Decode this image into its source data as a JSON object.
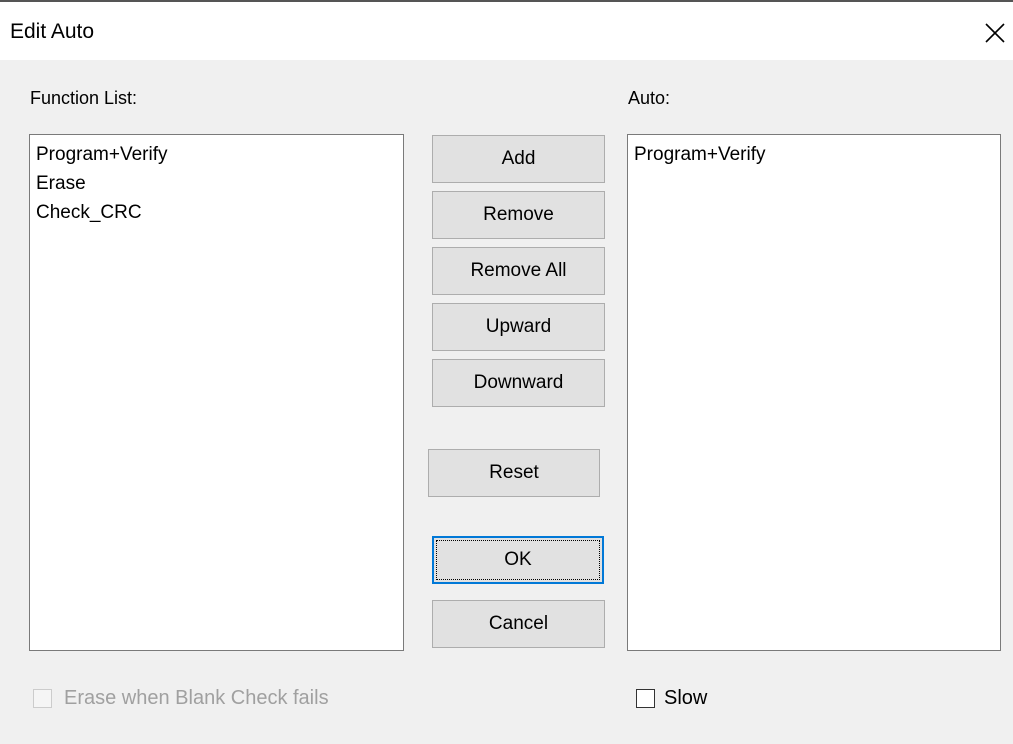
{
  "window": {
    "title": "Edit Auto"
  },
  "function_list": {
    "label": "Function List:",
    "items": [
      "Program+Verify",
      "Erase",
      "Check_CRC"
    ]
  },
  "auto_list": {
    "label": "Auto:",
    "items": [
      "Program+Verify"
    ]
  },
  "buttons": {
    "add": "Add",
    "remove": "Remove",
    "remove_all": "Remove All",
    "upward": "Upward",
    "downward": "Downward",
    "reset": "Reset",
    "ok": "OK",
    "cancel": "Cancel"
  },
  "options": {
    "erase_when_blank_check_fails": {
      "label": "Erase when Blank Check fails",
      "checked": false,
      "enabled": false
    },
    "slow": {
      "label": "Slow",
      "checked": false,
      "enabled": true
    }
  },
  "colors": {
    "default_button_border": "#0078d7",
    "dialog_bg": "#f0f0f0",
    "disabled_text": "#a0a0a0"
  }
}
